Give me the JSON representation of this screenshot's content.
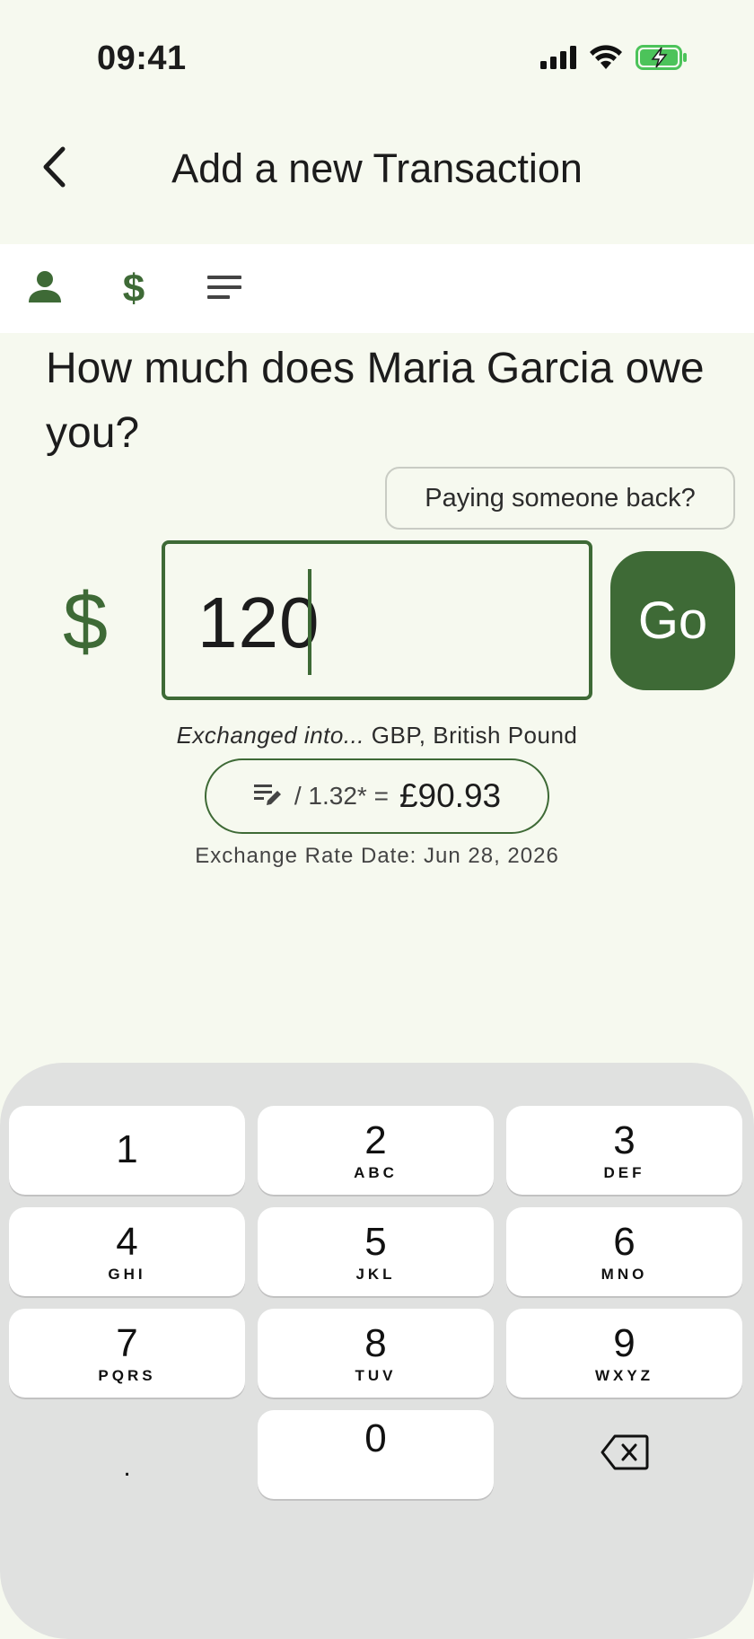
{
  "status_bar": {
    "time": "09:41",
    "icons": [
      "signal-icon",
      "wifi-icon",
      "battery-charging-icon"
    ]
  },
  "header": {
    "back_icon": "chevron-left-icon",
    "title": "Add a new Transaction"
  },
  "steps": {
    "icons": [
      "person-icon",
      "dollar-icon",
      "notes-icon"
    ],
    "active_step": 1
  },
  "question": "How much does Maria Garcia owe you?",
  "payback_button": "Paying someone back?",
  "amount": {
    "currency_symbol": "$",
    "value": "120"
  },
  "go_button": "Go",
  "exchange": {
    "intro": "Exchanged into...",
    "currency": "GBP, British Pound",
    "formula": "/ 1.32* =",
    "result": "£90.93",
    "edit_icon": "edit-notes-icon",
    "date_text": "Exchange Rate Date: Jun 28, 2026"
  },
  "keypad": {
    "keys": [
      {
        "digit": "1",
        "letters": ""
      },
      {
        "digit": "2",
        "letters": "ABC"
      },
      {
        "digit": "3",
        "letters": "DEF"
      },
      {
        "digit": "4",
        "letters": "GHI"
      },
      {
        "digit": "5",
        "letters": "JKL"
      },
      {
        "digit": "6",
        "letters": "MNO"
      },
      {
        "digit": "7",
        "letters": "PQRS"
      },
      {
        "digit": "8",
        "letters": "TUV"
      },
      {
        "digit": "9",
        "letters": "WXYZ"
      },
      {
        "digit": ".",
        "letters": ""
      },
      {
        "digit": "0",
        "letters": ""
      }
    ],
    "delete_icon": "backspace-icon"
  },
  "colors": {
    "accent": "#3e6a36",
    "background": "#f6f9ef",
    "keyboard": "#e0e1e0"
  }
}
